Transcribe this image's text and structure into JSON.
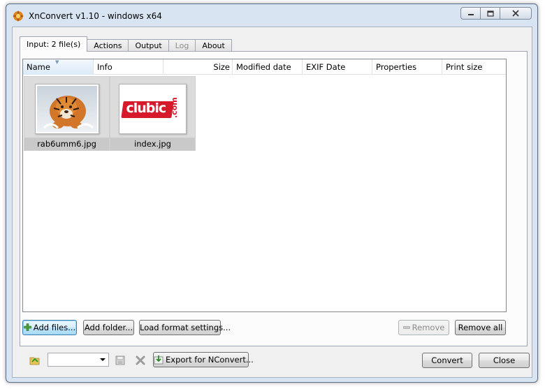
{
  "window": {
    "title": "XnConvert v1.10 - windows x64"
  },
  "tabs": [
    {
      "label": "Input: 2 file(s)",
      "state": "active"
    },
    {
      "label": "Actions",
      "state": "normal"
    },
    {
      "label": "Output",
      "state": "normal"
    },
    {
      "label": "Log",
      "state": "disabled"
    },
    {
      "label": "About",
      "state": "normal"
    }
  ],
  "columns": [
    "Name",
    "Info",
    "Size",
    "Modified date",
    "EXIF Date",
    "Properties",
    "Print size"
  ],
  "files": [
    {
      "name": "rab6umm6.jpg",
      "thumbnail": "tiger-image"
    },
    {
      "name": "index.jpg",
      "thumbnail": "clubic-logo-image",
      "logo_text": "clubic",
      "logo_suffix": ".com"
    }
  ],
  "input_buttons": {
    "add_files": "Add files...",
    "add_folder": "Add folder...",
    "load_format": "Load format settings...",
    "remove": "Remove",
    "remove_all": "Remove all"
  },
  "footer": {
    "combo_value": "",
    "export": "Export for NConvert...",
    "convert": "Convert",
    "close": "Close"
  },
  "colors": {
    "accent_red": "#d6192b",
    "titlebar": "#d8e4f1"
  }
}
